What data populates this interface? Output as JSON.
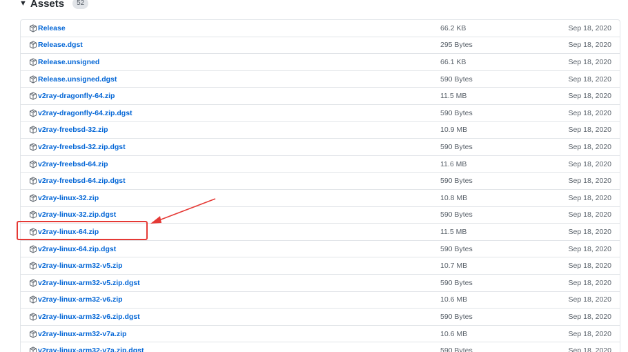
{
  "assets": {
    "title": "Assets",
    "count": "52",
    "rows": [
      {
        "name": "Release",
        "size": "66.2 KB",
        "date": "Sep 18, 2020"
      },
      {
        "name": "Release.dgst",
        "size": "295 Bytes",
        "date": "Sep 18, 2020"
      },
      {
        "name": "Release.unsigned",
        "size": "66.1 KB",
        "date": "Sep 18, 2020"
      },
      {
        "name": "Release.unsigned.dgst",
        "size": "590 Bytes",
        "date": "Sep 18, 2020"
      },
      {
        "name": "v2ray-dragonfly-64.zip",
        "size": "11.5 MB",
        "date": "Sep 18, 2020"
      },
      {
        "name": "v2ray-dragonfly-64.zip.dgst",
        "size": "590 Bytes",
        "date": "Sep 18, 2020"
      },
      {
        "name": "v2ray-freebsd-32.zip",
        "size": "10.9 MB",
        "date": "Sep 18, 2020"
      },
      {
        "name": "v2ray-freebsd-32.zip.dgst",
        "size": "590 Bytes",
        "date": "Sep 18, 2020"
      },
      {
        "name": "v2ray-freebsd-64.zip",
        "size": "11.6 MB",
        "date": "Sep 18, 2020"
      },
      {
        "name": "v2ray-freebsd-64.zip.dgst",
        "size": "590 Bytes",
        "date": "Sep 18, 2020"
      },
      {
        "name": "v2ray-linux-32.zip",
        "size": "10.8 MB",
        "date": "Sep 18, 2020"
      },
      {
        "name": "v2ray-linux-32.zip.dgst",
        "size": "590 Bytes",
        "date": "Sep 18, 2020"
      },
      {
        "name": "v2ray-linux-64.zip",
        "size": "11.5 MB",
        "date": "Sep 18, 2020"
      },
      {
        "name": "v2ray-linux-64.zip.dgst",
        "size": "590 Bytes",
        "date": "Sep 18, 2020"
      },
      {
        "name": "v2ray-linux-arm32-v5.zip",
        "size": "10.7 MB",
        "date": "Sep 18, 2020"
      },
      {
        "name": "v2ray-linux-arm32-v5.zip.dgst",
        "size": "590 Bytes",
        "date": "Sep 18, 2020"
      },
      {
        "name": "v2ray-linux-arm32-v6.zip",
        "size": "10.6 MB",
        "date": "Sep 18, 2020"
      },
      {
        "name": "v2ray-linux-arm32-v6.zip.dgst",
        "size": "590 Bytes",
        "date": "Sep 18, 2020"
      },
      {
        "name": "v2ray-linux-arm32-v7a.zip",
        "size": "10.6 MB",
        "date": "Sep 18, 2020"
      },
      {
        "name": "v2ray-linux-arm32-v7a.zip.dgst",
        "size": "590 Bytes",
        "date": "Sep 18, 2020"
      }
    ]
  },
  "icons": {
    "asset": "package-icon",
    "caret": "triangle-down-icon"
  },
  "annotation": {
    "color": "#e53935",
    "highlighted_row": "v2ray-linux-64.zip"
  },
  "colors": {
    "link": "#0366d6",
    "muted": "#586069",
    "border": "#e1e4e8"
  }
}
